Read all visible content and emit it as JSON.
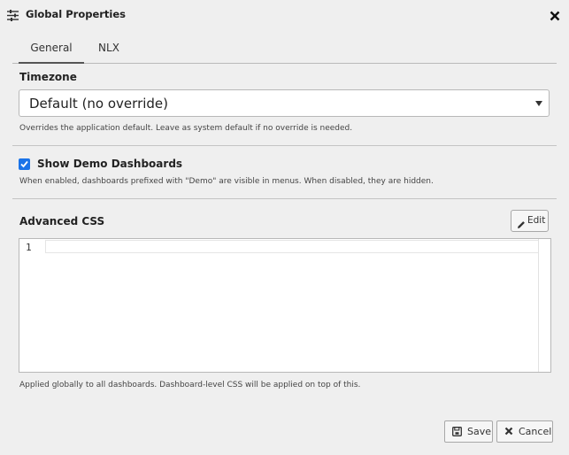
{
  "dialog": {
    "title": "Global Properties",
    "title_icon": "sliders-icon",
    "close_icon": "close-icon"
  },
  "tabs": [
    {
      "label": "General",
      "active": true
    },
    {
      "label": "NLX",
      "active": false
    }
  ],
  "timezone": {
    "label": "Timezone",
    "selected": "Default (no override)",
    "help": "Overrides the application default. Leave as system default if no override is needed."
  },
  "demo_dashboards": {
    "label": "Show Demo Dashboards",
    "checked": true,
    "help": "When enabled, dashboards prefixed with \"Demo\" are visible in menus. When disabled, they are hidden."
  },
  "advanced_css": {
    "label": "Advanced CSS",
    "edit_label": "Edit",
    "line_number": "1",
    "help": "Applied globally to all dashboards. Dashboard-level CSS will be applied on top of this."
  },
  "footer": {
    "save_label": "Save",
    "cancel_label": "Cancel"
  },
  "colors": {
    "accent": "#1a73e8",
    "background": "#efefef"
  }
}
